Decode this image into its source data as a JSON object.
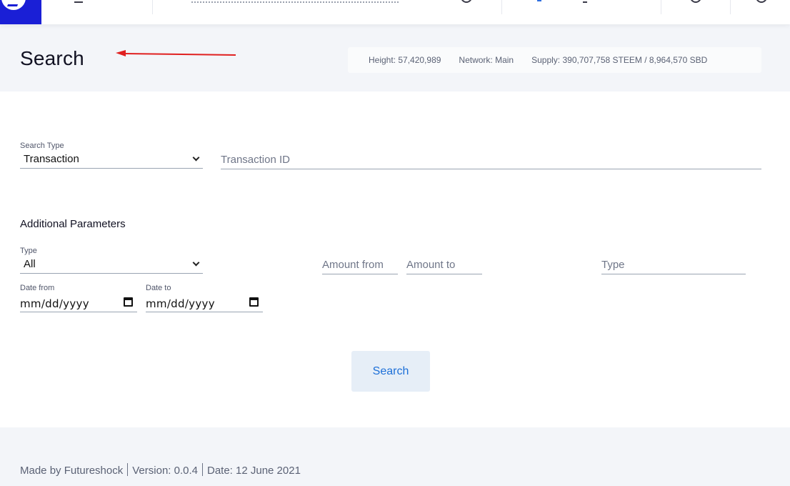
{
  "nav": {
    "logo_icon": "steem-logo-icon"
  },
  "header": {
    "title": "Search",
    "stats": {
      "height": "Height: 57,420,989",
      "network": "Network: Main",
      "supply": "Supply: 390,707,758 STEEM / 8,964,570 SBD"
    },
    "annotation_color": "#e02020"
  },
  "form": {
    "search_type_label": "Search Type",
    "search_type_value": "Transaction",
    "transaction_id_placeholder": "Transaction ID",
    "additional_title": "Additional Parameters",
    "type_label": "Type",
    "type_value": "All",
    "amount_from_placeholder": "Amount from",
    "amount_to_placeholder": "Amount to",
    "type_input_placeholder": "Type",
    "date_from_label": "Date from",
    "date_from_value": "mm/dd/yyyy",
    "date_to_label": "Date to",
    "date_to_value": "mm/dd/yyyy",
    "search_button": "Search"
  },
  "footer": {
    "made_by": "Made by Futureshock",
    "version": "Version: 0.0.4",
    "date": "Date: 12 June 2021"
  },
  "colors": {
    "brand": "#1a1fd6",
    "accent": "#1c6fd8",
    "band": "#f3f5f9"
  }
}
